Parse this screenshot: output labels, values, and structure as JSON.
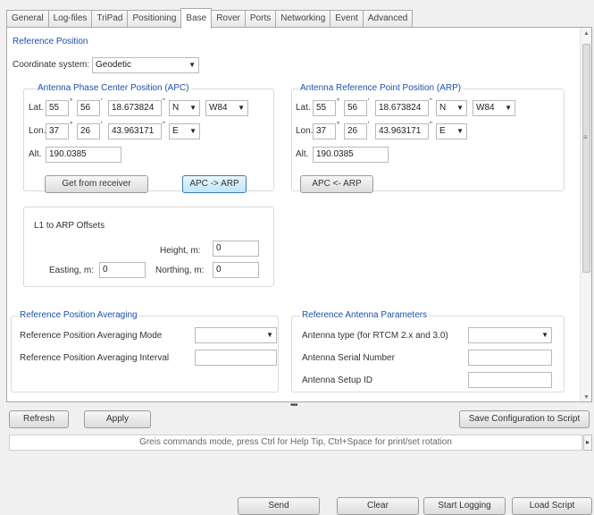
{
  "tabs": [
    "General",
    "Log-files",
    "TriPad",
    "Positioning",
    "Base",
    "Rover",
    "Ports",
    "Networking",
    "Event",
    "Advanced"
  ],
  "active_tab": "Base",
  "reference_position": {
    "title": "Reference Position",
    "coord_label": "Coordinate system:",
    "coord_value": "Geodetic"
  },
  "apc": {
    "title": "Antenna Phase Center Position (APC)",
    "lat_label": "Lat.",
    "lat_deg": "55",
    "lat_min": "56",
    "lat_sec": "18.673824",
    "lat_hem": "N",
    "datum": "W84",
    "lon_label": "Lon.",
    "lon_deg": "37",
    "lon_min": "26",
    "lon_sec": "43.963171",
    "lon_hem": "E",
    "alt_label": "Alt.",
    "alt": "190.0385",
    "get_button": "Get from receiver",
    "to_arp_button": "APC -> ARP"
  },
  "arp": {
    "title": "Antenna Reference Point Position (ARP)",
    "lat_label": "Lat.",
    "lat_deg": "55",
    "lat_min": "56",
    "lat_sec": "18.673824",
    "lat_hem": "N",
    "datum": "W84",
    "lon_label": "Lon.",
    "lon_deg": "37",
    "lon_min": "26",
    "lon_sec": "43.963171",
    "lon_hem": "E",
    "alt_label": "Alt.",
    "alt": "190.0385",
    "to_apc_button": "APC <- ARP"
  },
  "offsets": {
    "title": "L1 to ARP Offsets",
    "height_label": "Height, m:",
    "height": "0",
    "easting_label": "Easting, m:",
    "easting": "0",
    "northing_label": "Northing, m:",
    "northing": "0"
  },
  "averaging": {
    "title": "Reference Position Averaging",
    "mode_label": "Reference Position Averaging Mode",
    "mode_value": "",
    "interval_label": "Reference Position Averaging Interval",
    "interval_value": ""
  },
  "antenna_params": {
    "title": "Reference Antenna Parameters",
    "type_label": "Antenna type (for RTCM 2.x and 3.0)",
    "type_value": "",
    "serial_label": "Antenna Serial Number",
    "serial_value": "",
    "setup_label": "Antenna Setup ID",
    "setup_value": ""
  },
  "toolbar": {
    "refresh": "Refresh",
    "apply": "Apply",
    "save_config": "Save Configuration to Script"
  },
  "console": {
    "hint": "Greis commands mode, press Ctrl for Help Tip, Ctrl+Space for print/set rotation",
    "text": ""
  },
  "bottom_buttons": {
    "send": "Send",
    "clear": "Clear",
    "start_logging": "Start Logging",
    "load_script": "Load Script"
  }
}
